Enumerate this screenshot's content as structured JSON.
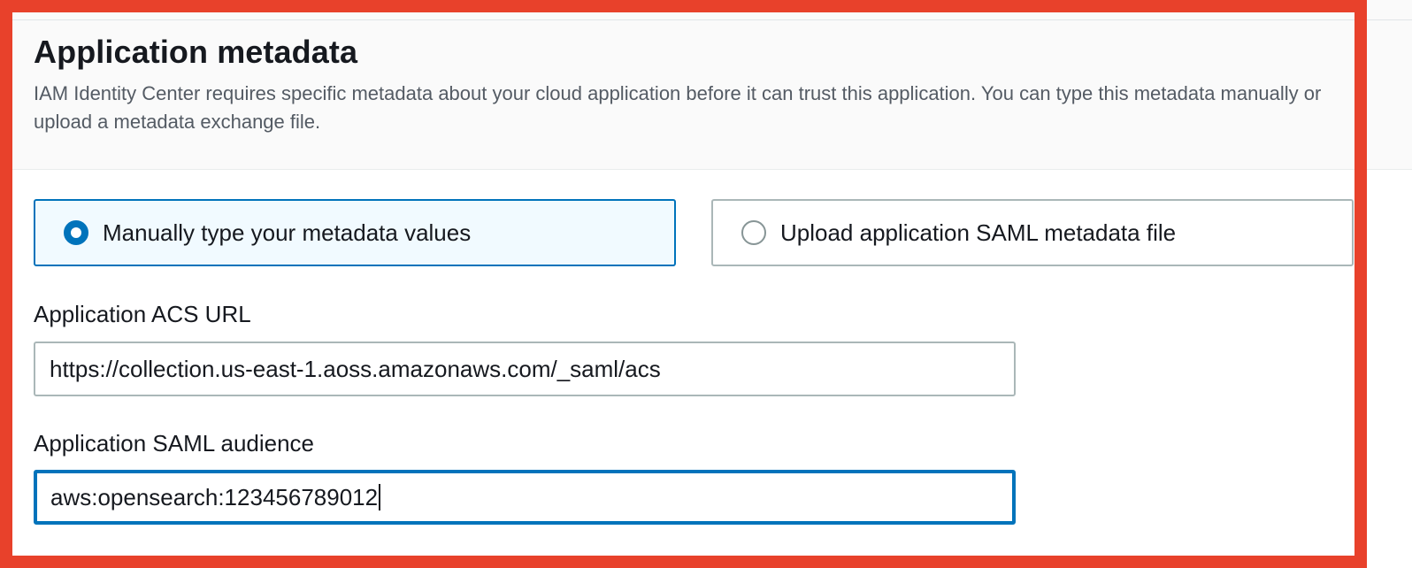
{
  "section": {
    "title": "Application metadata",
    "description": "IAM Identity Center requires specific metadata about your cloud application before it can trust this application. You can type this metadata manually or upload a metadata exchange file."
  },
  "metadata_options": [
    {
      "label": "Manually type your metadata values",
      "selected": true
    },
    {
      "label": "Upload application SAML metadata file",
      "selected": false
    }
  ],
  "fields": {
    "acs_url": {
      "label": "Application ACS URL",
      "value": "https://collection.us-east-1.aoss.amazonaws.com/_saml/acs"
    },
    "saml_audience": {
      "label": "Application SAML audience",
      "value": "aws:opensearch:123456789012",
      "focused": true
    }
  },
  "colors": {
    "accent": "#0073bb",
    "highlight_frame": "#e8412b",
    "selected_tile_bg": "#f1faff"
  }
}
